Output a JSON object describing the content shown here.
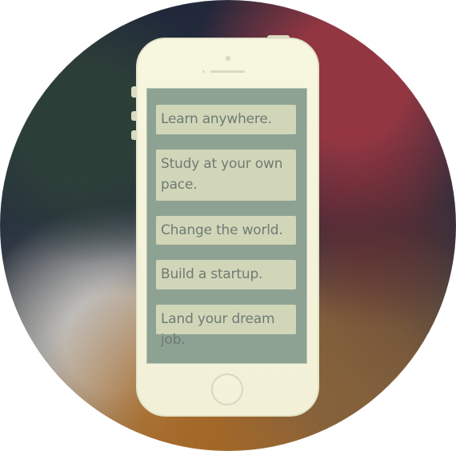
{
  "phone_messages": [
    "Learn anywhere.",
    "Study at your own pace.",
    "Change the world.",
    "Build a startup.",
    "Land your dream job."
  ]
}
